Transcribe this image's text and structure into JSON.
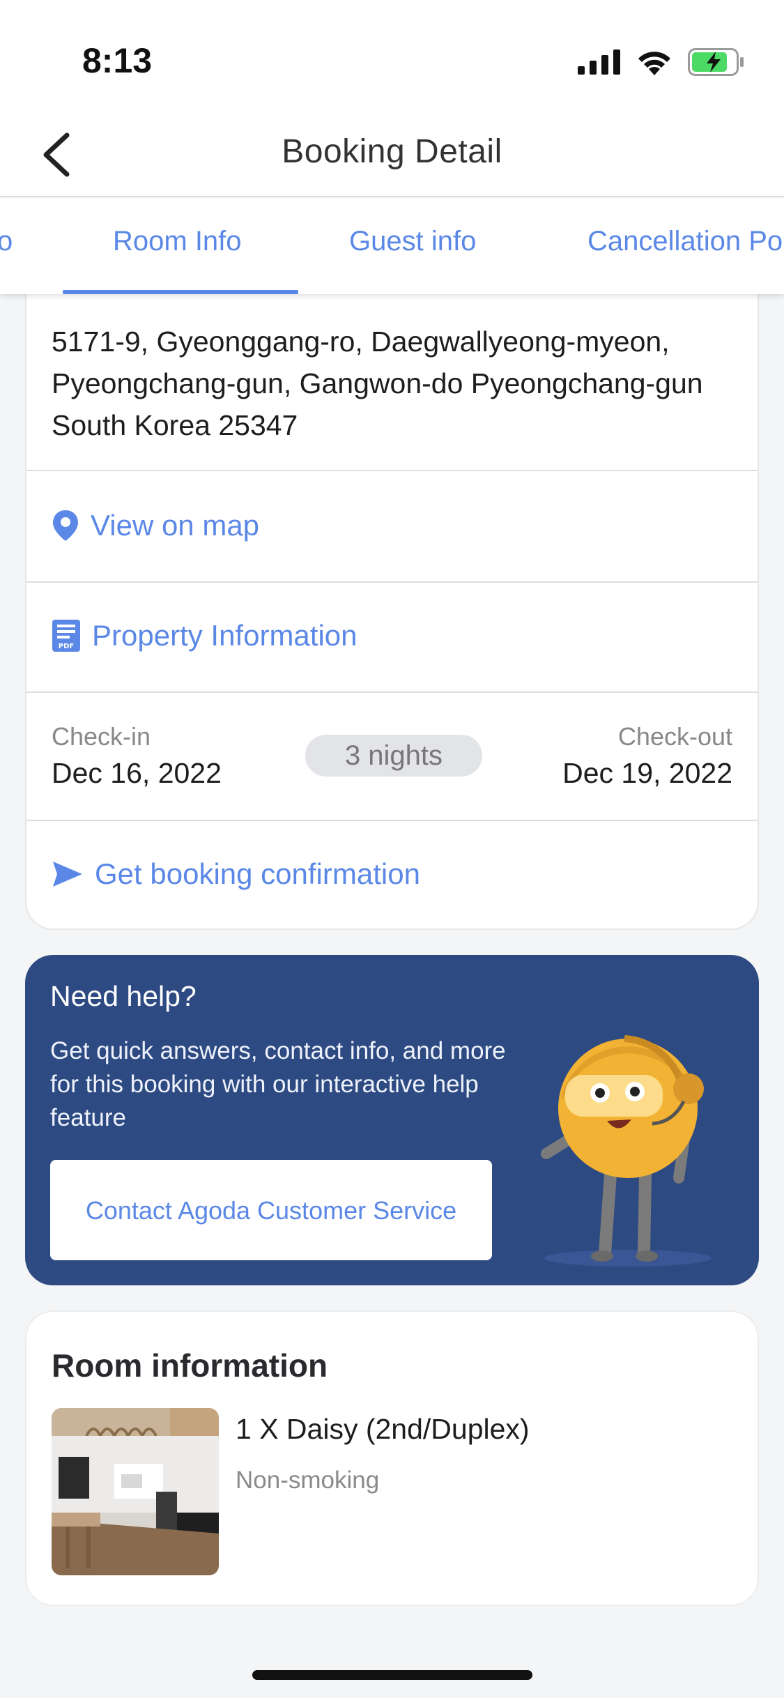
{
  "status_bar": {
    "time": "8:13",
    "battery_color": "#4cd964"
  },
  "header": {
    "title": "Booking Detail",
    "back_icon": "chevron-left-icon"
  },
  "tabs": [
    {
      "label": "o",
      "active": false
    },
    {
      "label": "Room Info",
      "active": true
    },
    {
      "label": "Guest info",
      "active": false
    },
    {
      "label": "Cancellation Po",
      "active": false
    }
  ],
  "property": {
    "address": "5171-9, Gyeonggang-ro, Daegwallyeong-myeon, Pyeongchang-gun, Gangwon-do Pyeongchang-gun South Korea 25347",
    "view_map_label": "View on map",
    "property_info_label": "Property Information",
    "checkin_label": "Check-in",
    "checkin_date": "Dec 16, 2022",
    "nights": "3 nights",
    "checkout_label": "Check-out",
    "checkout_date": "Dec 19, 2022",
    "confirmation_label": "Get booking confirmation"
  },
  "help": {
    "title": "Need help?",
    "text": "Get quick answers, contact info, and more for this booking with our interactive help feature",
    "button_label": "Contact Agoda Customer Service",
    "background_color": "#2e4a82"
  },
  "room": {
    "section_title": "Room information",
    "name": "1 X Daisy (2nd/Duplex)",
    "smoking": "Non-smoking"
  },
  "colors": {
    "accent": "#5b88e6",
    "text": "#1d1d1f"
  }
}
